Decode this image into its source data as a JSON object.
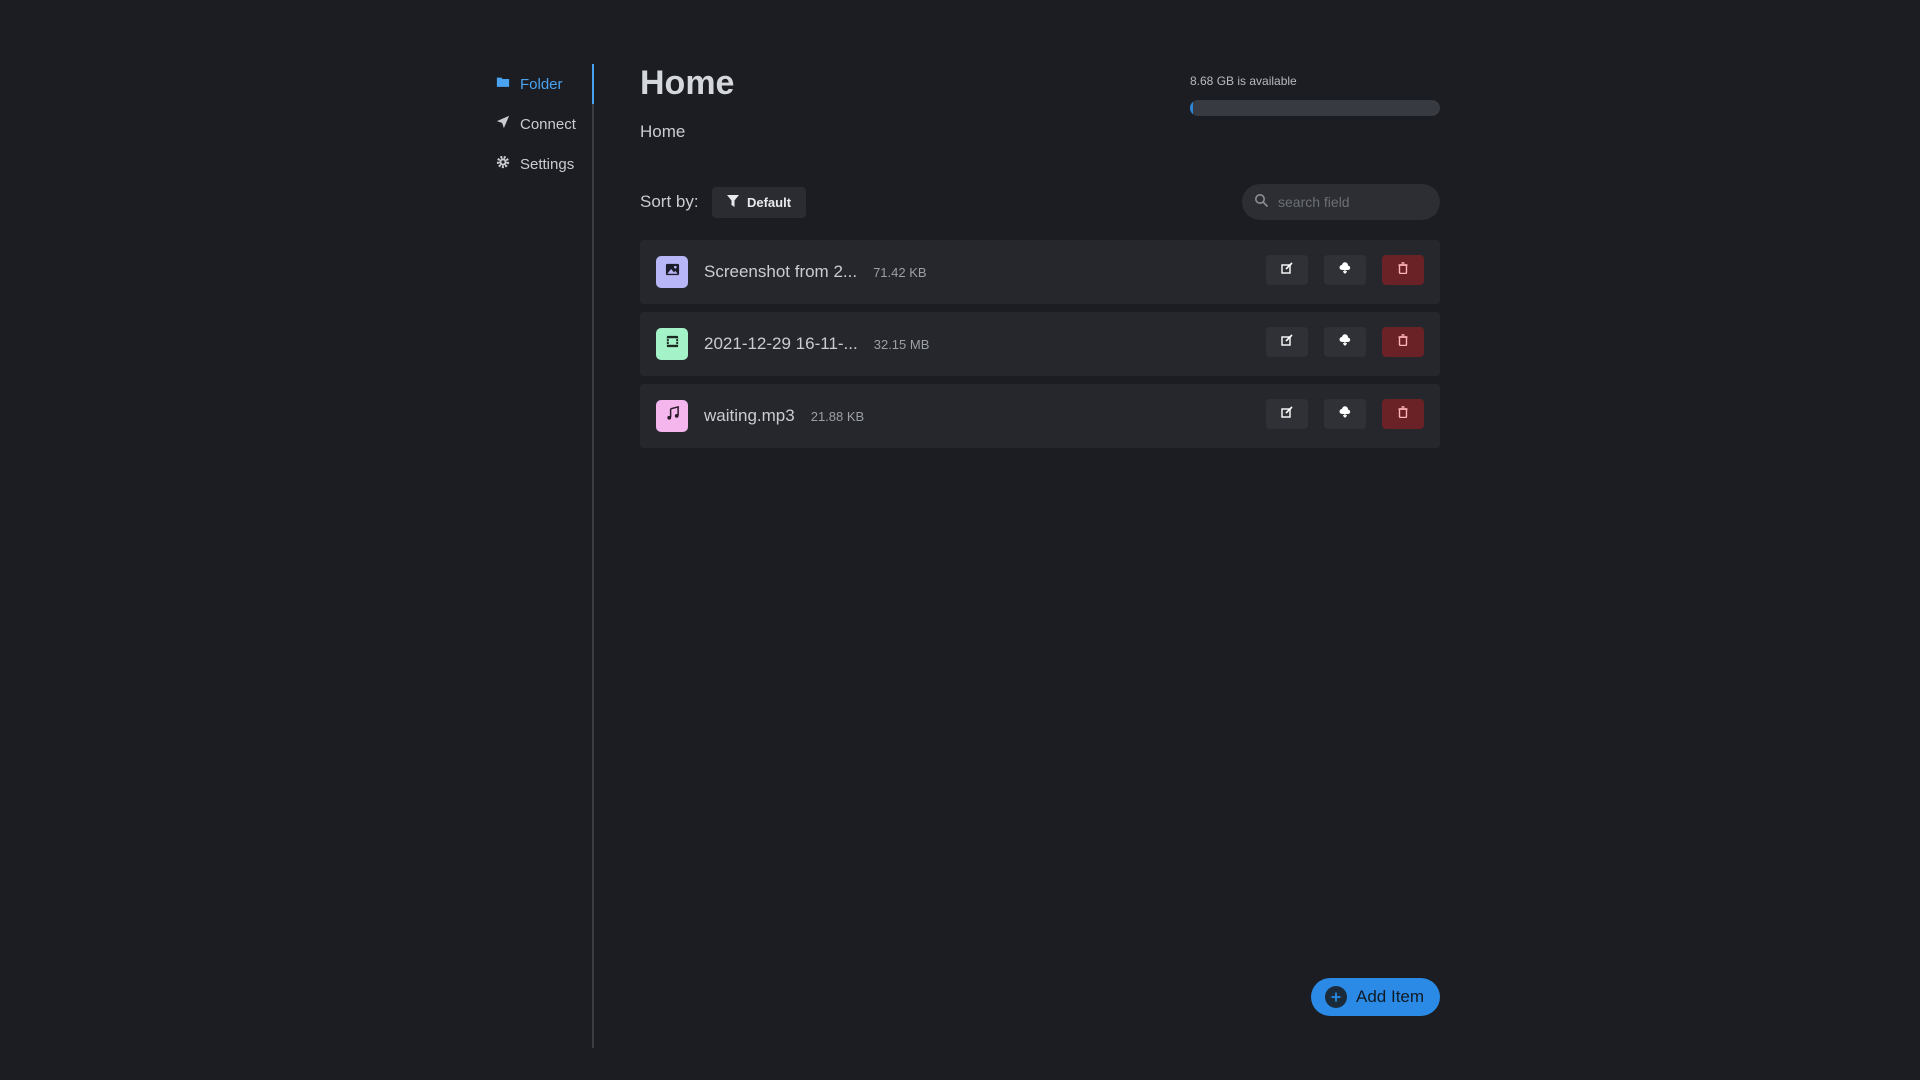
{
  "sidebar": {
    "items": [
      {
        "label": "Folder",
        "icon": "folder-icon",
        "active": true
      },
      {
        "label": "Connect",
        "icon": "send-icon",
        "active": false
      },
      {
        "label": "Settings",
        "icon": "gear-icon",
        "active": false
      }
    ]
  },
  "header": {
    "title": "Home",
    "breadcrumb": "Home"
  },
  "storage": {
    "text": "8.68 GB is available",
    "used_fraction": 0.01
  },
  "sort": {
    "label": "Sort by:",
    "value": "Default"
  },
  "search": {
    "placeholder": "search field",
    "value": ""
  },
  "files": [
    {
      "name": "Screenshot from 2...",
      "size": "71.42 KB",
      "type": "image",
      "icon": "image-icon",
      "icon_bg": "#b9b6f7"
    },
    {
      "name": "2021-12-29 16-11-...",
      "size": "32.15 MB",
      "type": "video",
      "icon": "film-icon",
      "icon_bg": "#a3f2c8"
    },
    {
      "name": "waiting.mp3",
      "size": "21.88 KB",
      "type": "audio",
      "icon": "music-icon",
      "icon_bg": "#f5b6ee"
    }
  ],
  "add_button": {
    "label": "Add Item"
  },
  "colors": {
    "accent": "#2a8ae6",
    "danger": "#6a2227",
    "background": "#1b1d22"
  }
}
